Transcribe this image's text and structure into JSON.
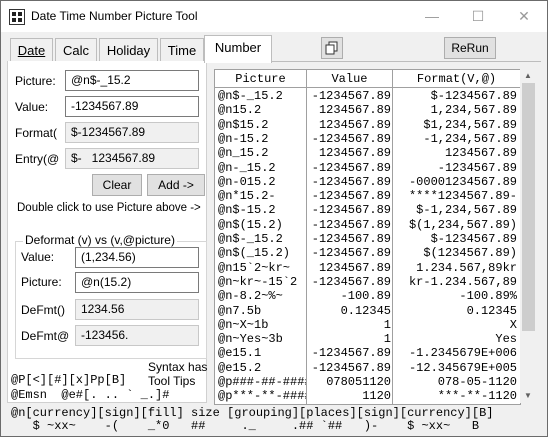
{
  "window": {
    "title": "Date Time Number Picture Tool",
    "minimize": "—",
    "maximize": "☐",
    "close": "✕"
  },
  "tabs": [
    {
      "label": "Date",
      "underline": "D"
    },
    {
      "label": "Calc",
      "underline": "C"
    },
    {
      "label": "Holiday",
      "underline": "H"
    },
    {
      "label": "Time",
      "underline": "T"
    },
    {
      "label": "Number",
      "underline": "N"
    }
  ],
  "active_tab": "Number",
  "toolbar": {
    "copy_icon": "copy-icon",
    "rerun_label": "ReRun"
  },
  "form": {
    "picture_label": "Picture:",
    "picture_value": "@n$-_15.2",
    "value_label": "Value:",
    "value_value": "-1234567.89",
    "format_label": "Format(",
    "format_value": "$-1234567.89",
    "entry_label": "Entry(@",
    "entry_value": "$-   1234567.89",
    "clear_label": "Clear",
    "add_label": "Add ->",
    "hint": "Double click to use Picture above ->"
  },
  "deformat": {
    "legend": "Deformat (v)  vs  (v,@picture)",
    "value_label": "Value:",
    "value_value": "(1,234.56)",
    "picture_label": "Picture:",
    "picture_value": "@n(15.2)",
    "defmt_label": "DeFmt()",
    "defmt_value": "1234.56",
    "defmt_at_label": "DeFmt@",
    "defmt_at_value": "-123456."
  },
  "syntax_note": "Syntax has\nTool Tips",
  "syntax_line1": "@P[<][#][x]Pp[B]",
  "syntax_line2": "@Emsn  @e#[. .. ` _.]#",
  "syntax_line3": "@n[currency][sign][fill] size [grouping][places][sign][currency][B]",
  "syntax_line4": "   $ ~xx~    -(    _*0   ##     ._     .## `##   )-    $ ~xx~   B",
  "grid": {
    "columns": [
      "Picture",
      "Value",
      "Format(V,@)"
    ],
    "rows": [
      [
        "@n$-_15.2",
        "-1234567.89",
        "$-1234567.89"
      ],
      [
        "@n15.2",
        "1234567.89",
        "1,234,567.89"
      ],
      [
        "@n$15.2",
        "1234567.89",
        "$1,234,567.89"
      ],
      [
        "@n-15.2",
        "-1234567.89",
        "-1,234,567.89"
      ],
      [
        "@n_15.2",
        "1234567.89",
        "1234567.89"
      ],
      [
        "@n-_15.2",
        "-1234567.89",
        "-1234567.89"
      ],
      [
        "@n-015.2",
        "-1234567.89",
        "-00001234567.89"
      ],
      [
        "@n*15.2-",
        "-1234567.89",
        "****1234567.89-"
      ],
      [
        "@n$-15.2",
        "-1234567.89",
        "$-1,234,567.89"
      ],
      [
        "@n$(15.2)",
        "-1234567.89",
        "$(1,234,567.89)"
      ],
      [
        "@n$-_15.2",
        "-1234567.89",
        "$-1234567.89"
      ],
      [
        "@n$(_15.2)",
        "-1234567.89",
        "$(1234567.89)"
      ],
      [
        "@n15`2~kr~",
        "1234567.89",
        "1.234.567,89kr"
      ],
      [
        "@n~kr~-15`2",
        "-1234567.89",
        "kr-1.234.567,89"
      ],
      [
        "@n-8.2~%~",
        "-100.89",
        "-100.89%"
      ],
      [
        "@n7.5b",
        "0.12345",
        "0.12345"
      ],
      [
        "@n~X~1b",
        "1",
        "X"
      ],
      [
        "@n~Yes~3b",
        "1",
        "Yes"
      ],
      [
        "@e15.1",
        "-1234567.89",
        "-1.2345679E+006"
      ],
      [
        "@e15.2",
        "-1234567.89",
        "-12.345679E+005"
      ],
      [
        "@p###-##-####",
        "078051120",
        "078-05-1120"
      ],
      [
        "@p***-**-####",
        "1120",
        "***-**-1120"
      ]
    ]
  }
}
